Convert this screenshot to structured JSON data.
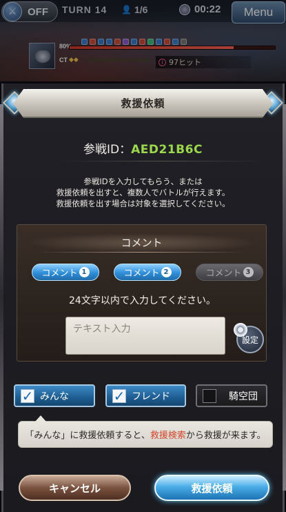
{
  "hud": {
    "auto_label": "OFF",
    "turn_label": "TURN 14",
    "players": "1/6",
    "timer": "00:22",
    "menu_label": "Menu",
    "boss_hp_percent_label": "80",
    "boss_hp_fraction": 0.8,
    "ct_label": "CT",
    "hits_label": "97ヒット"
  },
  "dialog": {
    "title": "救援依頼",
    "battle_id_label": "参戦ID：",
    "battle_id_code": "AED21B6C",
    "description": [
      "参戦IDを入力してもらう、または",
      "救援依頼を出すと、複数人でバトルが行えます。",
      "救援依頼を出す場合は対象を選択してください。"
    ],
    "comment": {
      "title": "コメント",
      "tabs": [
        {
          "label": "コメント",
          "num": "1",
          "active": true
        },
        {
          "label": "コメント",
          "num": "2",
          "active": true
        },
        {
          "label": "コメント",
          "num": "3",
          "active": false
        }
      ],
      "limit_text": "24文字以内で入力してください。",
      "input_placeholder": "テキスト入力",
      "settings_label": "設定"
    },
    "targets": [
      {
        "label": "みんな",
        "checked": true
      },
      {
        "label": "フレンド",
        "checked": true
      },
      {
        "label": "騎空団",
        "checked": false
      }
    ],
    "tooltip": {
      "part1": "「みんな」に救援依頼すると、",
      "highlight": "救援検索",
      "part2": "から救援が来ます。"
    },
    "cancel_label": "キャンセル",
    "send_label": "救援依頼"
  },
  "colors": {
    "battle_id_accent": "#9cd84d",
    "tooltip_highlight": "#d2462c",
    "primary_button": "#2f8ed8"
  }
}
